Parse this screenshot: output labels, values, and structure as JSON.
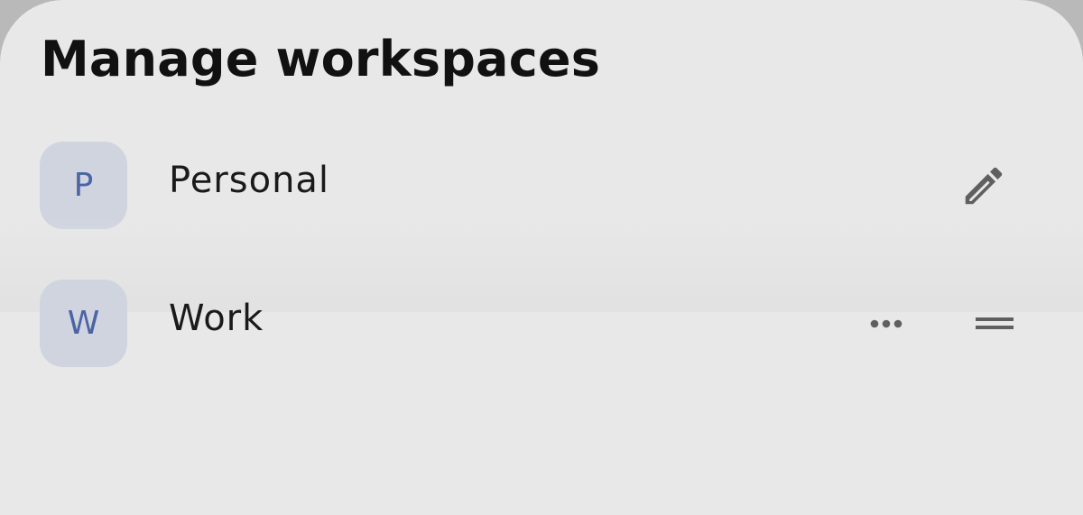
{
  "title": "Manage workspaces",
  "workspaces": [
    {
      "initial": "P",
      "name": "Personal",
      "action_icon": "pencil-icon"
    },
    {
      "initial": "W",
      "name": "Work",
      "action_icons": [
        "more-horizontal-icon",
        "drag-handle-icon"
      ]
    }
  ],
  "colors": {
    "sheet_background": "#e8e8e8",
    "avatar_background": "#cfd4df",
    "avatar_text": "#4a64a6",
    "icon": "#5f5f5f"
  }
}
